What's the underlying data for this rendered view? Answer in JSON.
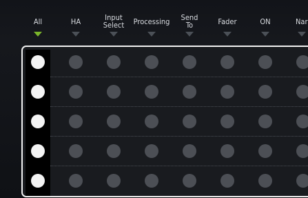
{
  "columns": [
    {
      "label": "All",
      "active": true
    },
    {
      "label": "HA",
      "active": false
    },
    {
      "label": "Input\nSelect",
      "active": false
    },
    {
      "label": "Processing",
      "active": false
    },
    {
      "label": "Send\nTo",
      "active": false
    },
    {
      "label": "Fader",
      "active": false
    },
    {
      "label": "ON",
      "active": false
    },
    {
      "label": "Nar",
      "active": false
    }
  ],
  "rows": [
    {
      "cells": [
        "on",
        "off",
        "off",
        "off",
        "off",
        "off",
        "off",
        "off"
      ]
    },
    {
      "cells": [
        "on",
        "off",
        "off",
        "off",
        "off",
        "off",
        "off",
        "off"
      ]
    },
    {
      "cells": [
        "on",
        "off",
        "off",
        "off",
        "off",
        "off",
        "off",
        "off"
      ]
    },
    {
      "cells": [
        "on",
        "off",
        "off",
        "off",
        "off",
        "off",
        "off",
        "off"
      ]
    },
    {
      "cells": [
        "on",
        "off",
        "off",
        "off",
        "off",
        "off",
        "off",
        "off"
      ]
    }
  ],
  "colors": {
    "accent_arrow": "#7bb52b",
    "inactive_arrow": "#4b5057",
    "dot_on": "#f4f4f4",
    "dot_off": "#4c4f55",
    "frame": "#f2f2f2"
  }
}
